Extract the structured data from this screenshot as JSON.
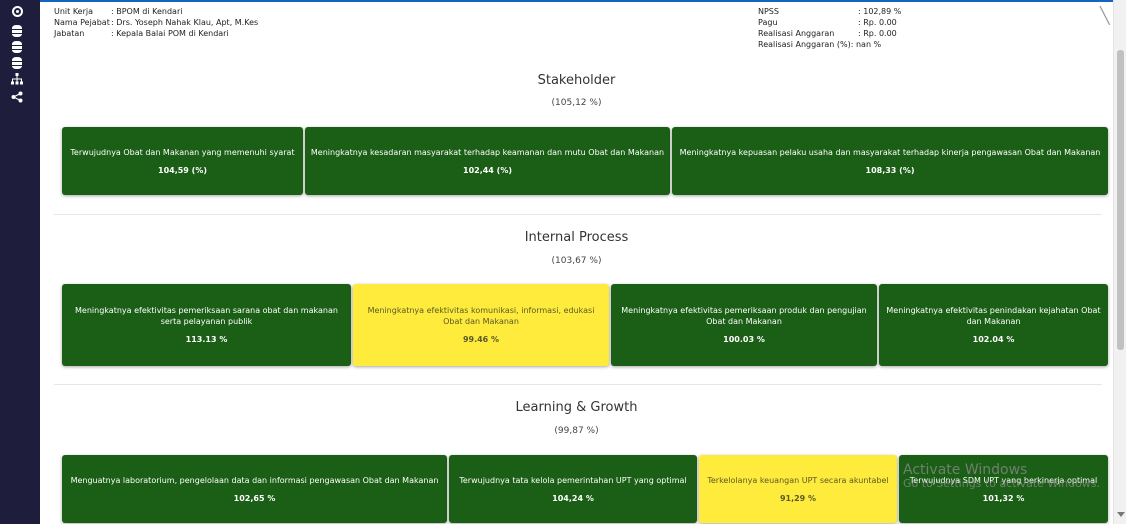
{
  "sidebar": {
    "icons": [
      "target-icon",
      "database-icon",
      "database-icon",
      "database-icon",
      "sitemap-icon",
      "share-icon"
    ]
  },
  "info_left": {
    "unit_kerja": {
      "label": "Unit Kerja",
      "value": ": BPOM di Kendari"
    },
    "nama_pejabat": {
      "label": "Nama Pejabat",
      "value": ": Drs. Yoseph Nahak Klau, Apt, M.Kes"
    },
    "jabatan": {
      "label": "Jabatan",
      "value": ": Kepala Balai POM di Kendari"
    }
  },
  "info_right": {
    "npss": {
      "label": "NPSS",
      "value": ": 102,89 %"
    },
    "pagu": {
      "label": "Pagu",
      "value": ": Rp. 0.00"
    },
    "realisasi": {
      "label": "Realisasi Anggaran",
      "value": ": Rp. 0.00"
    },
    "realisasi_pct": {
      "label": "Realisasi Anggaran (%)",
      "value": ": nan %"
    }
  },
  "sections": [
    {
      "title": "Stakeholder",
      "percent": "(105,12 %)",
      "cards": [
        {
          "title": "Terwujudnya Obat dan Makanan yang memenuhi syarat",
          "value": "104,59 (%)",
          "status": "green"
        },
        {
          "title": "Meningkatnya kesadaran masyarakat terhadap keamanan dan mutu Obat dan Makanan",
          "value": "102,44 (%)",
          "status": "green"
        },
        {
          "title": "Meningkatnya kepuasan pelaku usaha dan masyarakat terhadap kinerja pengawasan Obat dan Makanan",
          "value": "108,33 (%)",
          "status": "green"
        }
      ]
    },
    {
      "title": "Internal Process",
      "percent": "(103,67 %)",
      "cards": [
        {
          "title": "Meningkatnya efektivitas pemeriksaan sarana obat dan makanan serta pelayanan publik",
          "value": "113.13 %",
          "status": "green"
        },
        {
          "title": "Meningkatnya efektivitas komunikasi, informasi, edukasi Obat dan Makanan",
          "value": "99.46 %",
          "status": "yellow"
        },
        {
          "title": "Meningkatnya efektivitas pemeriksaan produk dan pengujian Obat dan Makanan",
          "value": "100.03 %",
          "status": "green"
        },
        {
          "title": "Meningkatnya efektivitas penindakan kejahatan Obat dan Makanan",
          "value": "102.04 %",
          "status": "green"
        }
      ]
    },
    {
      "title": "Learning & Growth",
      "percent": "(99,87 %)",
      "cards": [
        {
          "title": "Menguatnya laboratorium, pengelolaan data dan informasi pengawasan Obat dan Makanan",
          "value": "102,65 %",
          "status": "green"
        },
        {
          "title": "Terwujudnya tata kelola pemerintahan UPT yang optimal",
          "value": "104,24 %",
          "status": "green"
        },
        {
          "title": "Terkelolanya keuangan UPT secara akuntabel",
          "value": "91,29 %",
          "status": "yellow"
        },
        {
          "title": "Terwujudnya SDM UPT yang berkinerja optimal",
          "value": "101,32 %",
          "status": "green"
        }
      ]
    }
  ],
  "colors": {
    "green": "#1b5e16",
    "yellow": "#ffeb3b",
    "sidebar": "#1e1e3c",
    "accent": "#1565c0"
  },
  "watermark": {
    "line1": "Activate Windows",
    "line2": "Go to Settings to activate Windows."
  }
}
